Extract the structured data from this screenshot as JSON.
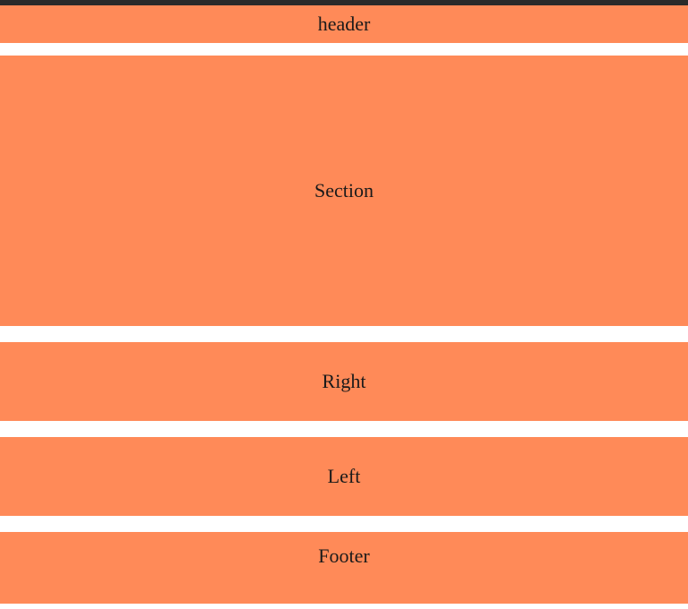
{
  "header": {
    "label": "header"
  },
  "section": {
    "label": "Section"
  },
  "right": {
    "label": "Right"
  },
  "left": {
    "label": "Left"
  },
  "footer": {
    "label": "Footer"
  },
  "colors": {
    "panel": "#ff8a58",
    "topbar": "#2a2a2a",
    "background": "#ffffff"
  }
}
